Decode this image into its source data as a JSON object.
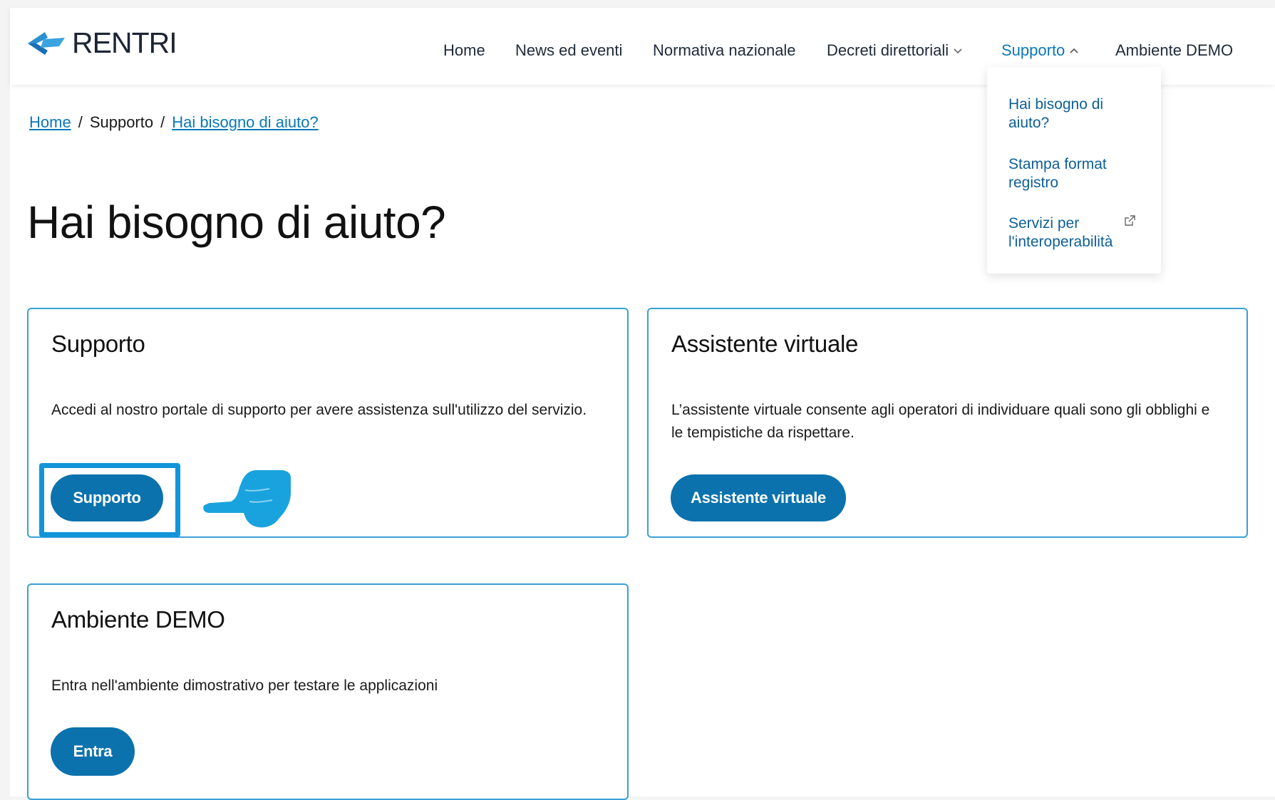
{
  "brand": {
    "name": "RENTRI"
  },
  "nav": {
    "items": [
      {
        "label": "Home"
      },
      {
        "label": "News ed eventi"
      },
      {
        "label": "Normativa nazionale"
      },
      {
        "label": "Decreti direttoriali"
      },
      {
        "label": "Supporto"
      },
      {
        "label": "Ambiente DEMO"
      }
    ]
  },
  "dropdown": {
    "items": [
      {
        "label": "Hai bisogno di aiuto?"
      },
      {
        "label": "Stampa format registro"
      },
      {
        "label": "Servizi per l'interoperabilità",
        "icon": "external-link-icon"
      }
    ]
  },
  "breadcrumb": {
    "items": [
      "Home",
      "Supporto",
      "Hai bisogno di aiuto?"
    ],
    "separator": "/"
  },
  "page": {
    "title": "Hai bisogno di aiuto?"
  },
  "cards": [
    {
      "title": "Supporto",
      "text": "Accedi al nostro portale di supporto per avere assistenza sull'utilizzo del servizio.",
      "button": "Supporto"
    },
    {
      "title": "Assistente virtuale",
      "text": "L’assistente virtuale consente agli operatori di individuare quali sono gli obblighi e le tempistiche da rispettare.",
      "button": "Assistente virtuale"
    },
    {
      "title": "Ambiente DEMO",
      "text": "Entra nell'ambiente dimostrativo per testare le applicazioni",
      "button": "Entra"
    }
  ],
  "colors": {
    "accent": "#0a78b8",
    "button": "#0b72ad",
    "card_border": "#3a9fd6",
    "highlight": "#1195d8"
  }
}
